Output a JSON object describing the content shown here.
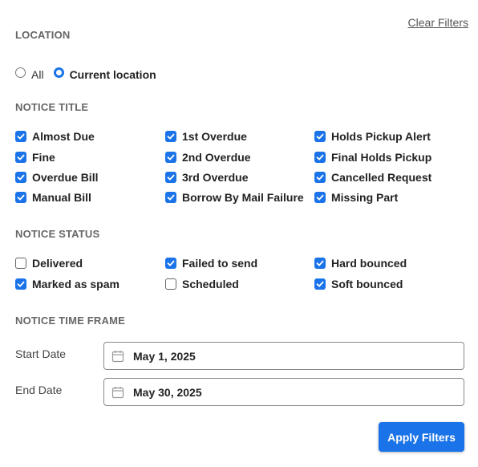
{
  "clear_filters_label": "Clear Filters",
  "location": {
    "title": "LOCATION",
    "options": [
      {
        "label": "All",
        "checked": false
      },
      {
        "label": "Current location",
        "checked": true
      }
    ]
  },
  "notice_title": {
    "title": "NOTICE TITLE",
    "items": [
      {
        "label": "Almost Due",
        "checked": true
      },
      {
        "label": "1st Overdue",
        "checked": true
      },
      {
        "label": "Holds Pickup Alert",
        "checked": true
      },
      {
        "label": "Fine",
        "checked": true
      },
      {
        "label": "2nd Overdue",
        "checked": true
      },
      {
        "label": "Final Holds Pickup",
        "checked": true
      },
      {
        "label": "Overdue Bill",
        "checked": true
      },
      {
        "label": "3rd Overdue",
        "checked": true
      },
      {
        "label": "Cancelled Request",
        "checked": true
      },
      {
        "label": "Manual Bill",
        "checked": true
      },
      {
        "label": "Borrow By Mail Failure",
        "checked": true
      },
      {
        "label": "Missing Part",
        "checked": true
      }
    ]
  },
  "notice_status": {
    "title": "NOTICE STATUS",
    "items": [
      {
        "label": "Delivered",
        "checked": false
      },
      {
        "label": "Failed to send",
        "checked": true
      },
      {
        "label": "Hard bounced",
        "checked": true
      },
      {
        "label": "Marked as spam",
        "checked": true
      },
      {
        "label": "Scheduled",
        "checked": false
      },
      {
        "label": "Soft bounced",
        "checked": true
      }
    ]
  },
  "time_frame": {
    "title": "NOTICE TIME FRAME",
    "start_label": "Start Date",
    "start_value": "May 1, 2025",
    "end_label": "End Date",
    "end_value": "May 30, 2025"
  },
  "apply_label": "Apply Filters",
  "colors": {
    "accent": "#1a73e8"
  },
  "icons": {
    "date": "calendar-icon",
    "check": "checkmark-icon"
  }
}
